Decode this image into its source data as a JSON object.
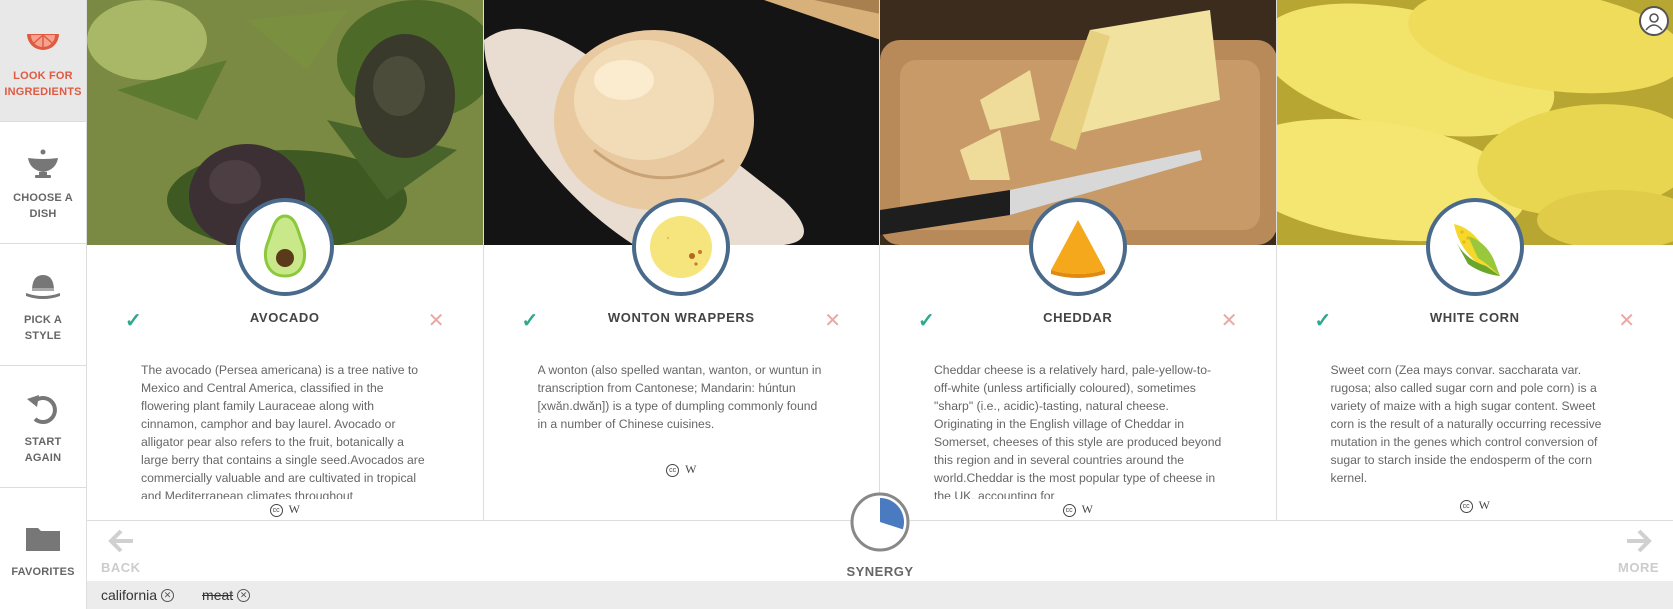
{
  "sidebar": {
    "items": [
      {
        "label_line1": "LOOK FOR",
        "label_line2": "INGREDIENTS",
        "icon": "citrus-slice-icon",
        "active": true
      },
      {
        "label_line1": "CHOOSE A",
        "label_line2": "DISH",
        "icon": "bowl-icon",
        "active": false
      },
      {
        "label_line1": "PICK A",
        "label_line2": "STYLE",
        "icon": "bowler-hat-icon",
        "active": false
      },
      {
        "label_line1": "START",
        "label_line2": "AGAIN",
        "icon": "undo-arrow-icon",
        "active": false
      },
      {
        "label_line1": "FAVORITES",
        "label_line2": "",
        "icon": "folder-icon",
        "active": false
      }
    ]
  },
  "cards": [
    {
      "name": "AVOCADO",
      "icon": "avocado-icon",
      "description": "The avocado (Persea americana) is a tree native to Mexico and Central America, classified in the flowering plant family Lauraceae along with cinnamon, camphor and bay laurel. Avocado or alligator pear also refers to the fruit, botanically a large berry that contains a single seed.Avocados are commercially valuable and are cultivated in tropical and Mediterranean climates throughout",
      "cc": "cc",
      "source": "W"
    },
    {
      "name": "WONTON WRAPPERS",
      "icon": "wonton-wrapper-icon",
      "description": "A wonton (also spelled wantan, wanton, or wuntun in transcription from Cantonese; Mandarin: húntun [xwǎn.dwǎn]) is a type of dumpling commonly found in a number of Chinese cuisines.",
      "cc": "cc",
      "source": "W"
    },
    {
      "name": "CHEDDAR",
      "icon": "cheese-wedge-icon",
      "description": "Cheddar cheese is a relatively hard, pale-yellow-to-off-white (unless artificially coloured), sometimes \"sharp\" (i.e., acidic)-tasting, natural cheese. Originating in the English village of Cheddar in Somerset, cheeses of this style are produced beyond this region and in several countries around the world.Cheddar is the most popular type of cheese in the UK, accounting for",
      "cc": "cc",
      "source": "W"
    },
    {
      "name": "WHITE CORN",
      "icon": "corn-cob-icon",
      "description": "Sweet corn (Zea mays convar. saccharata var. rugosa; also called sugar corn and pole corn) is a variety of maize with a high sugar content. Sweet corn is the result of a naturally occurring recessive mutation in the genes which control conversion of sugar to starch inside the endosperm of the corn kernel.",
      "cc": "cc",
      "source": "W"
    }
  ],
  "bottom": {
    "back_label": "BACK",
    "more_label": "MORE",
    "synergy_label": "SYNERGY",
    "synergy_fraction": 0.3
  },
  "tags": [
    {
      "text": "california",
      "struck": false
    },
    {
      "text": "meat",
      "struck": true
    }
  ],
  "colors": {
    "accent": "#e05a42",
    "check": "#2fa88c",
    "cross": "#e8a9a3",
    "badge_border": "#4a6a8c",
    "synergy_fill": "#4a7bc0"
  }
}
